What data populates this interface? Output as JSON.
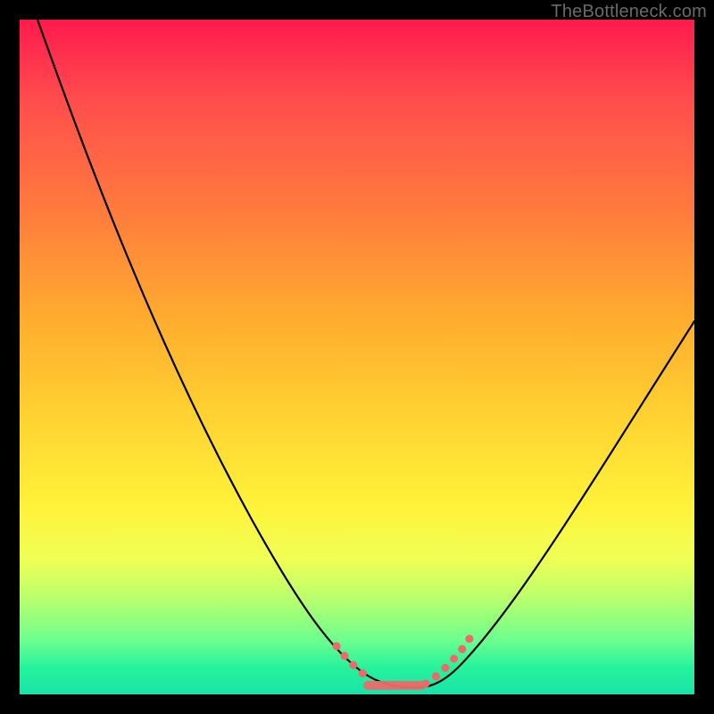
{
  "watermark": "TheBottleneck.com",
  "colors": {
    "frame": "#000000",
    "gradient_top": "#ff1a4d",
    "gradient_bottom": "#18e3a9",
    "curve": "#000000",
    "band": "#ed6a6a"
  },
  "chart_data": {
    "type": "line",
    "title": "",
    "xlabel": "",
    "ylabel": "",
    "xlim": [
      0,
      100
    ],
    "ylim": [
      0,
      100
    ],
    "x": [
      0,
      5,
      10,
      15,
      20,
      25,
      30,
      35,
      40,
      45,
      48,
      50,
      52,
      55,
      57,
      58,
      60,
      65,
      70,
      75,
      80,
      85,
      90,
      95,
      100
    ],
    "values": [
      100,
      89,
      78,
      67,
      56,
      45,
      35,
      25,
      17,
      8,
      4,
      2,
      1,
      0,
      0,
      0,
      1,
      4,
      10,
      17,
      24,
      31,
      38,
      45,
      52
    ],
    "highlight_band_x": [
      48,
      58
    ],
    "annotations": []
  }
}
